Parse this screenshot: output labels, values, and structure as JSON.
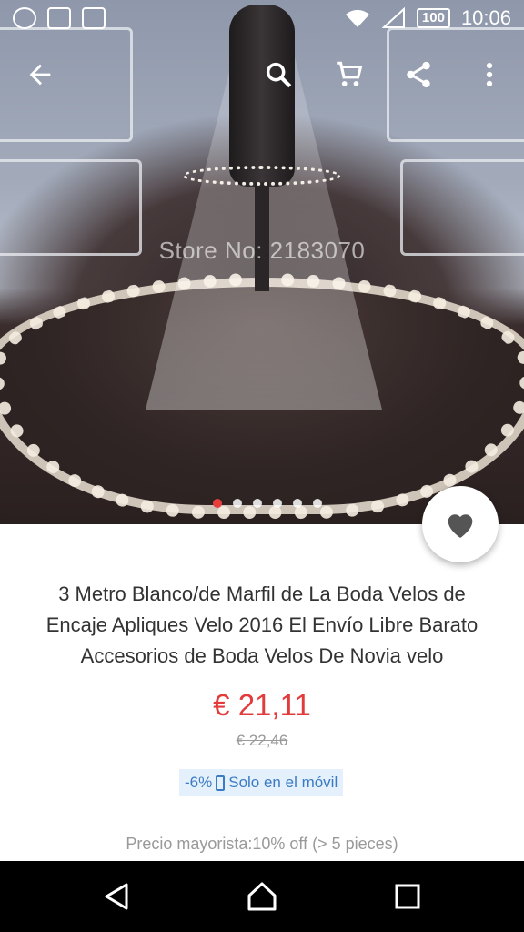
{
  "status_bar": {
    "battery": "100",
    "time": "10:06",
    "left_icons": [
      "barcode-app-icon",
      "checklist-app-icon",
      "play-store-icon"
    ],
    "right_icons": [
      "wifi-icon",
      "signal-icon",
      "battery-icon"
    ]
  },
  "toolbar": {
    "icons": [
      "back-arrow-icon",
      "search-icon",
      "cart-icon",
      "share-icon",
      "more-vert-icon"
    ]
  },
  "gallery": {
    "watermark": "Store No: 2183070",
    "page_count": 6,
    "active_index": 0
  },
  "product": {
    "title_line1": "3 Metro Blanco/de Marfil de La Boda Velos de",
    "title_line2": "Encaje Apliques Velo 2016 El Envío Libre Barato",
    "title_line3": "Accesorios de Boda Velos De Novia velo",
    "price": "€ 21,11",
    "old_price": "€ 22,46",
    "discount": "-6%",
    "mobile_only": "Solo en el móvil",
    "wholesale": "Precio mayorista:10% off (> 5 pieces)"
  },
  "colors": {
    "price": "#e33b3b",
    "promo_text": "#3b7bc4",
    "promo_bg": "#e4f0fb",
    "active_dot": "#e83e3e"
  },
  "nav": {
    "icons": [
      "back-triangle-icon",
      "home-icon",
      "recents-icon"
    ]
  }
}
